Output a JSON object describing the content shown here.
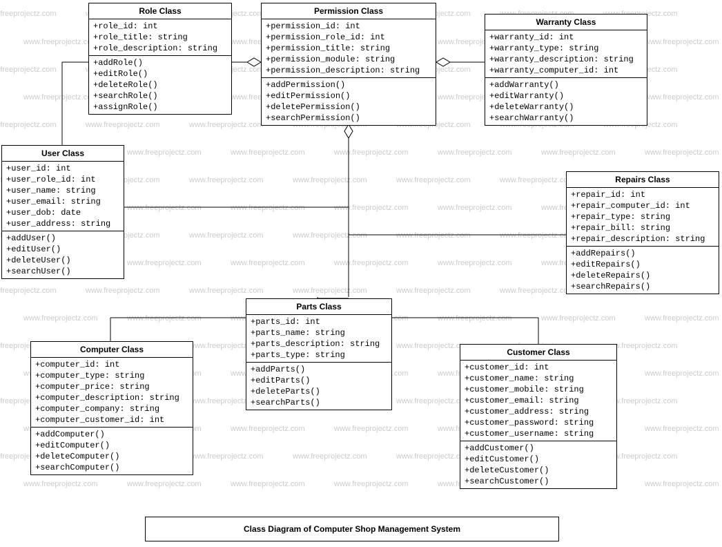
{
  "watermark_text": "www.freeprojectz.com",
  "diagram_title": "Class Diagram of Computer Shop Management System",
  "classes": {
    "role": {
      "title": "Role Class",
      "attributes": [
        "+role_id: int",
        "+role_title: string",
        "+role_description: string"
      ],
      "methods": [
        "+addRole()",
        "+editRole()",
        "+deleteRole()",
        "+searchRole()",
        "+assignRole()"
      ]
    },
    "permission": {
      "title": "Permission Class",
      "attributes": [
        "+permission_id: int",
        "+permission_role_id: int",
        "+permission_title: string",
        "+permission_module: string",
        "+permission_description: string"
      ],
      "methods": [
        "+addPermission()",
        "+editPermission()",
        "+deletePermission()",
        "+searchPermission()"
      ]
    },
    "warranty": {
      "title": "Warranty Class",
      "attributes": [
        "+warranty_id: int",
        "+warranty_type: string",
        "+warranty_description: string",
        "+warranty_computer_id: int"
      ],
      "methods": [
        "+addWarranty()",
        "+editWarranty()",
        "+deleteWarranty()",
        "+searchWarranty()"
      ]
    },
    "user": {
      "title": "User Class",
      "attributes": [
        "+user_id: int",
        "+user_role_id: int",
        "+user_name: string",
        "+user_email: string",
        "+user_dob: date",
        "+user_address: string"
      ],
      "methods": [
        "+addUser()",
        "+editUser()",
        "+deleteUser()",
        "+searchUser()"
      ]
    },
    "repairs": {
      "title": "Repairs Class",
      "attributes": [
        "+repair_id: int",
        "+repair_computer_id: int",
        "+repair_type: string",
        "+repair_bill: string",
        "+repair_description: string"
      ],
      "methods": [
        "+addRepairs()",
        "+editRepairs()",
        "+deleteRepairs()",
        "+searchRepairs()"
      ]
    },
    "parts": {
      "title": "Parts Class",
      "attributes": [
        "+parts_id: int",
        "+parts_name: string",
        "+parts_description: string",
        "+parts_type: string"
      ],
      "methods": [
        "+addParts()",
        "+editParts()",
        "+deleteParts()",
        "+searchParts()"
      ]
    },
    "computer": {
      "title": "Computer Class",
      "attributes": [
        "+computer_id: int",
        "+computer_type: string",
        "+computer_price: string",
        "+computer_description: string",
        "+computer_company: string",
        "+computer_customer_id: int"
      ],
      "methods": [
        "+addComputer()",
        "+editComputer()",
        "+deleteComputer()",
        "+searchComputer()"
      ]
    },
    "customer": {
      "title": "Customer Class",
      "attributes": [
        "+customer_id: int",
        "+customer_name: string",
        "+customer_mobile: string",
        "+customer_email: string",
        "+customer_address: string",
        "+customer_password: string",
        "+customer_username: string"
      ],
      "methods": [
        "+addCustomer()",
        "+editCustomer()",
        "+deleteCustomer()",
        "+searchCustomer()"
      ]
    }
  }
}
